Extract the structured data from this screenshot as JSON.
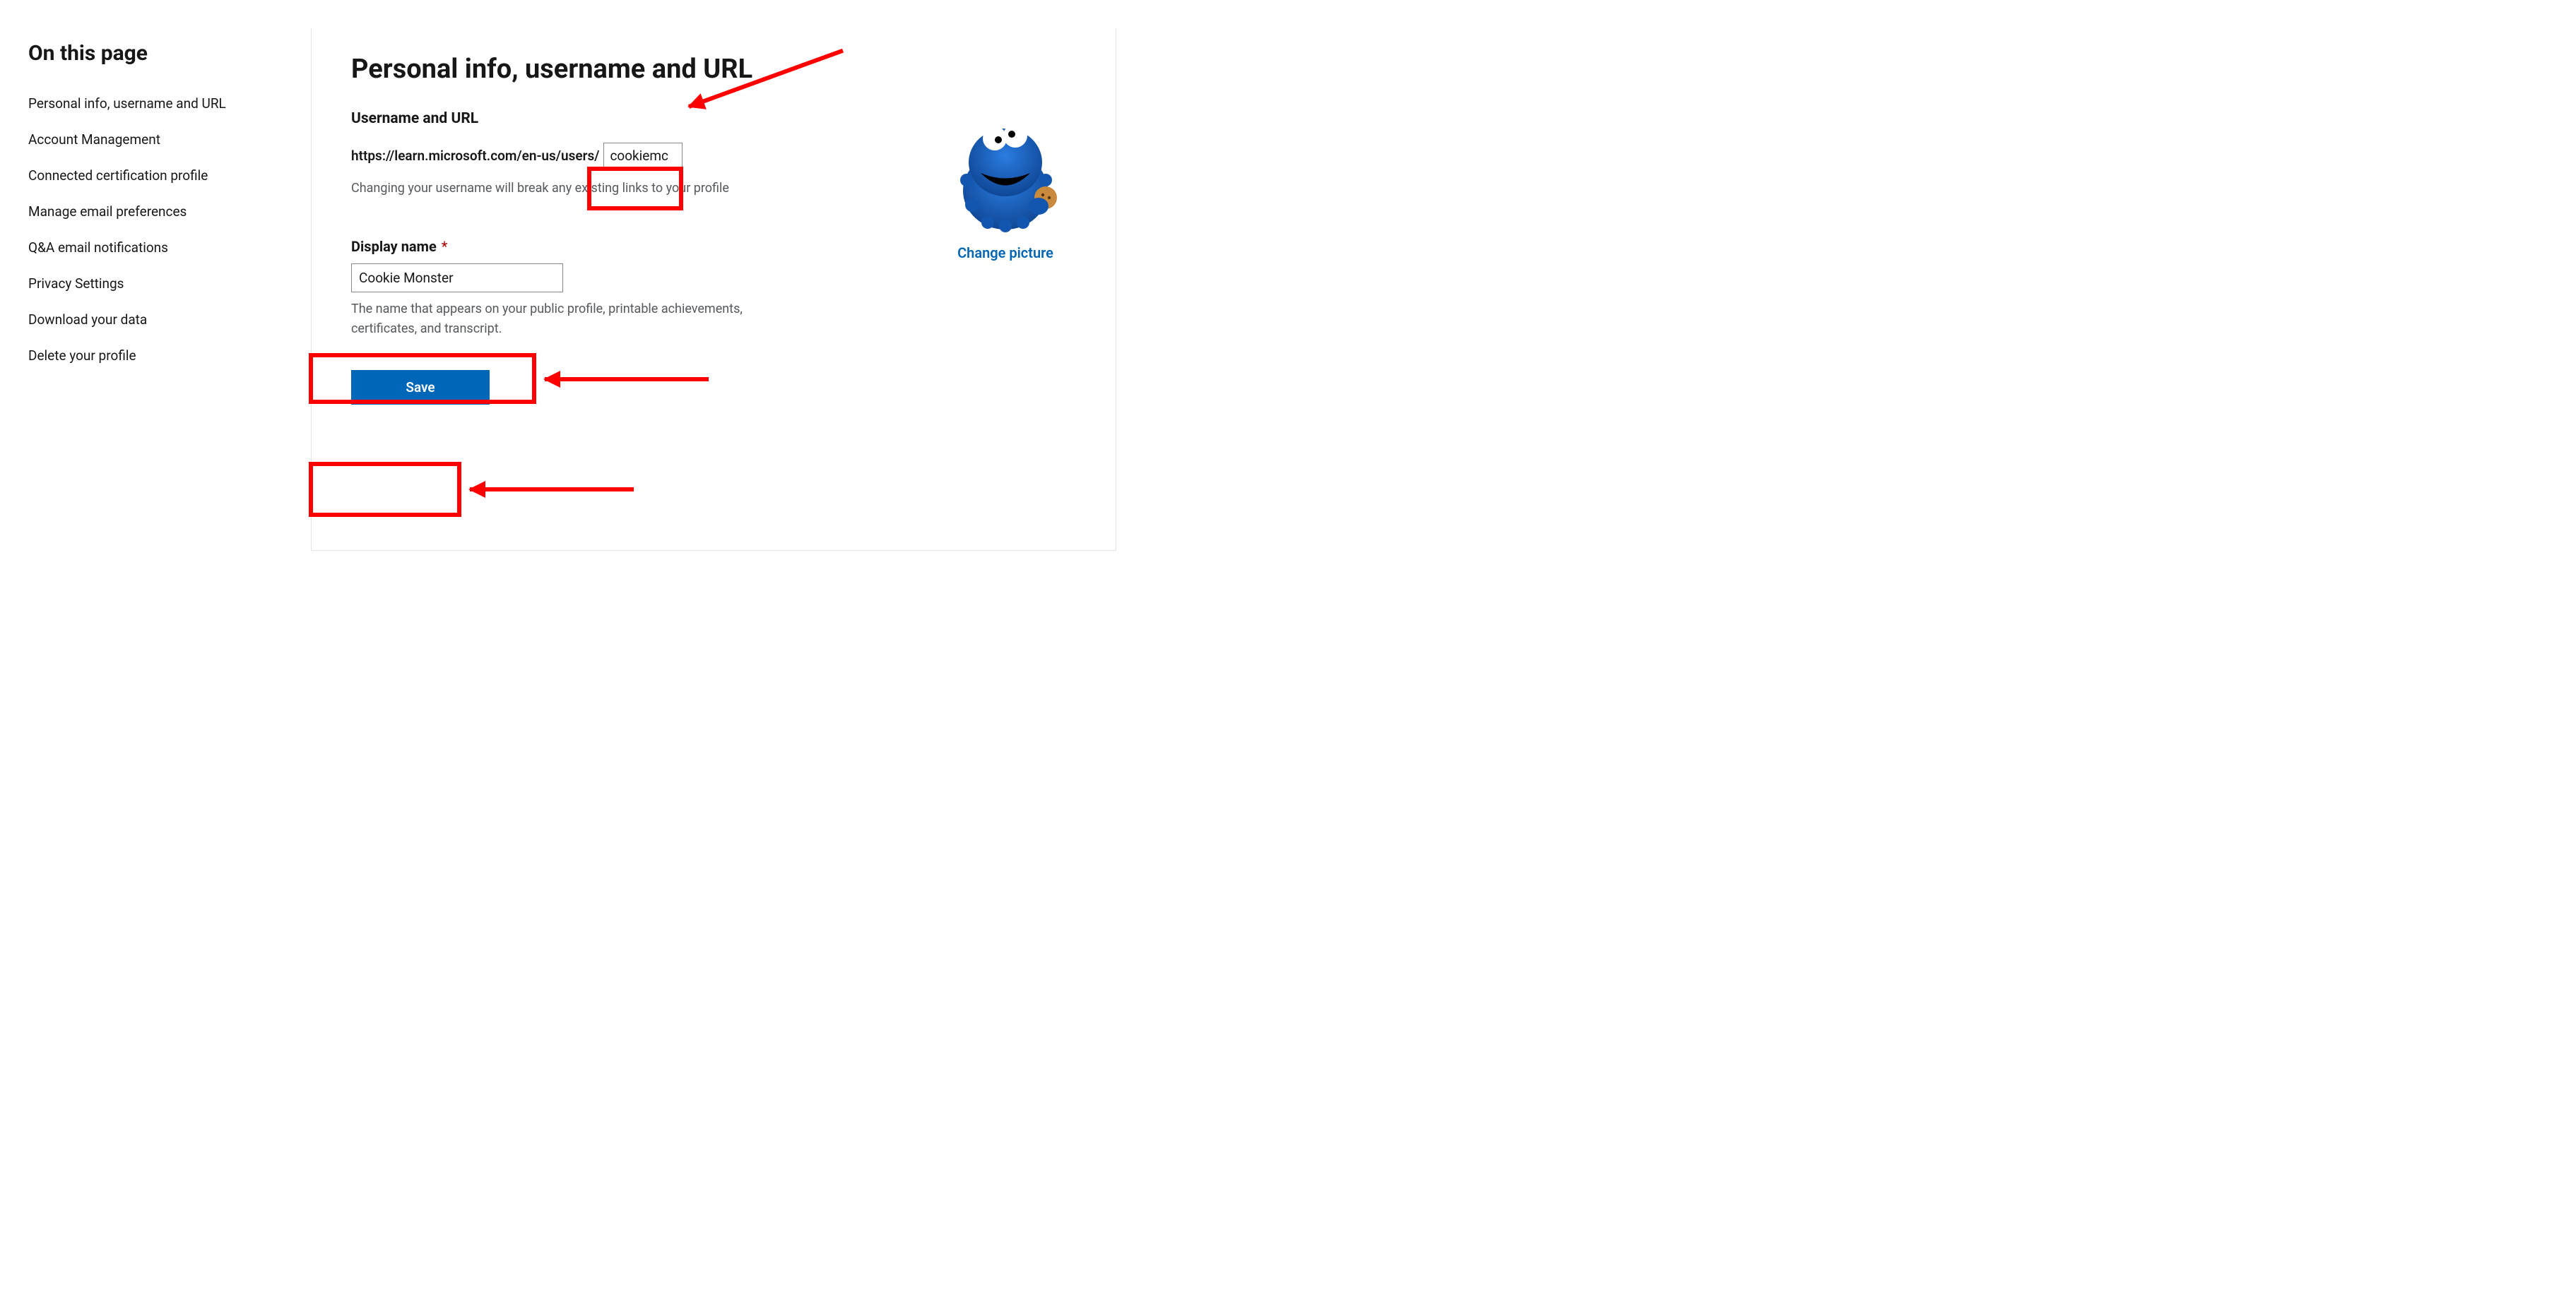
{
  "sidebar": {
    "heading": "On this page",
    "items": [
      {
        "label": "Personal info, username and URL"
      },
      {
        "label": "Account Management"
      },
      {
        "label": "Connected certification profile"
      },
      {
        "label": "Manage email preferences"
      },
      {
        "label": "Q&A email notifications"
      },
      {
        "label": "Privacy Settings"
      },
      {
        "label": "Download your data"
      },
      {
        "label": "Delete your profile"
      }
    ]
  },
  "main": {
    "title": "Personal info, username and URL",
    "username_section": {
      "heading": "Username and URL",
      "url_prefix": "https://learn.microsoft.com/en-us/users/",
      "username_value": "cookiemc",
      "hint": "Changing your username will break any existing links to your profile"
    },
    "display_name_section": {
      "label": "Display name",
      "required_mark": "*",
      "value": "Cookie Monster",
      "hint": "The name that appears on your public profile, printable achievements, certificates, and transcript."
    },
    "save_label": "Save",
    "avatar": {
      "change_label": "Change picture"
    }
  },
  "colors": {
    "annotation": "#ff0000",
    "primary": "#0067b8",
    "link": "#0065b3"
  }
}
